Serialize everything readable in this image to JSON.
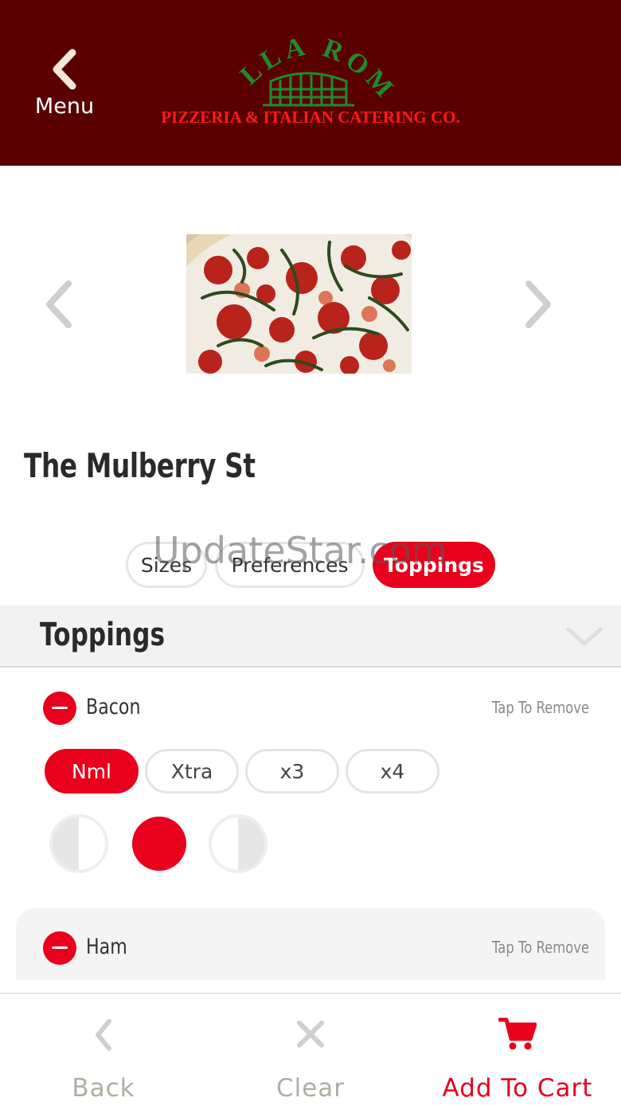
{
  "header": {
    "back_label": "Menu",
    "logo_top_text": "BELLA ROMA",
    "logo_bottom_text": "PIZZERIA & ITALIAN CATERING CO."
  },
  "item": {
    "title": "The Mulberry St",
    "image_alt": "pizza"
  },
  "tabs": [
    {
      "label": "Sizes",
      "active": false
    },
    {
      "label": "Preferences",
      "active": false
    },
    {
      "label": "Toppings",
      "active": true
    }
  ],
  "watermark": "UpdateStar.com",
  "section": {
    "title": "Toppings"
  },
  "toppings": [
    {
      "name": "Bacon",
      "action": "Tap To Remove",
      "quantities": [
        "Nml",
        "Xtra",
        "x3",
        "x4"
      ],
      "selected_quantity": "Nml",
      "portion_selected": "whole"
    },
    {
      "name": "Ham",
      "action": "Tap To Remove"
    }
  ],
  "bottom_bar": {
    "back_label": "Back",
    "clear_label": "Clear",
    "cart_label": "Add To Cart"
  },
  "colors": {
    "header_bg": "#5a0000",
    "accent": "#e8001c",
    "logo_green": "#1f8a2e",
    "logo_red": "#ff1a1a"
  },
  "icons": {
    "header_back": "chevron-left-icon",
    "carousel_prev": "chevron-left-icon",
    "carousel_next": "chevron-right-icon",
    "collapse": "chevron-down-icon",
    "remove": "minus-circle-icon",
    "back": "chevron-left-icon",
    "clear": "close-icon",
    "cart": "shopping-cart-icon"
  }
}
